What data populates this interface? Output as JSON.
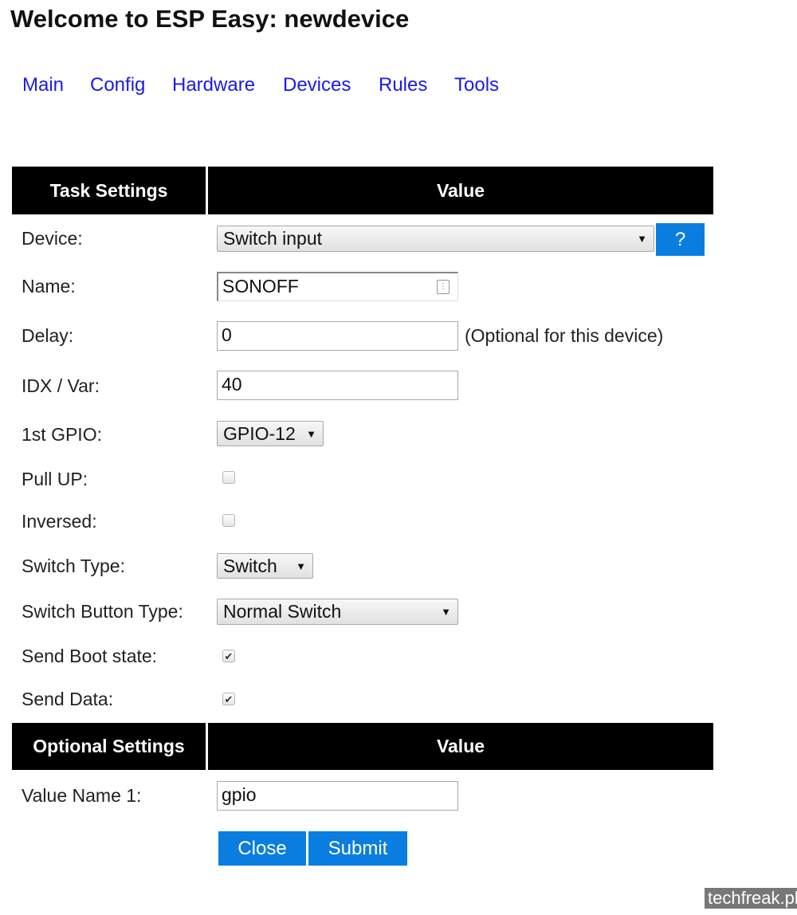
{
  "page": {
    "title": "Welcome to ESP Easy: newdevice"
  },
  "nav": [
    "Main",
    "Config",
    "Hardware",
    "Devices",
    "Rules",
    "Tools"
  ],
  "task_table": {
    "header_settings": "Task Settings",
    "header_value": "Value",
    "device": {
      "label": "Device:",
      "value": "Switch input",
      "help": "?"
    },
    "name": {
      "label": "Name:",
      "value": "SONOFF"
    },
    "delay": {
      "label": "Delay:",
      "value": "0",
      "note": "(Optional for this device)"
    },
    "idx": {
      "label": "IDX / Var:",
      "value": "40"
    },
    "gpio": {
      "label": "1st GPIO:",
      "value": "GPIO-12"
    },
    "pullup": {
      "label": "Pull UP:",
      "checked": false
    },
    "inversed": {
      "label": "Inversed:",
      "checked": false
    },
    "switch_type": {
      "label": "Switch Type:",
      "value": "Switch"
    },
    "button_type": {
      "label": "Switch Button Type:",
      "value": "Normal Switch"
    },
    "boot_state": {
      "label": "Send Boot state:",
      "checked": true
    },
    "send_data": {
      "label": "Send Data:",
      "checked": true
    }
  },
  "optional_table": {
    "header_settings": "Optional Settings",
    "header_value": "Value",
    "value_name_1": {
      "label": "Value Name 1:",
      "value": "gpio"
    }
  },
  "buttons": {
    "close": "Close",
    "submit": "Submit"
  },
  "watermark": "techfreak.pl"
}
